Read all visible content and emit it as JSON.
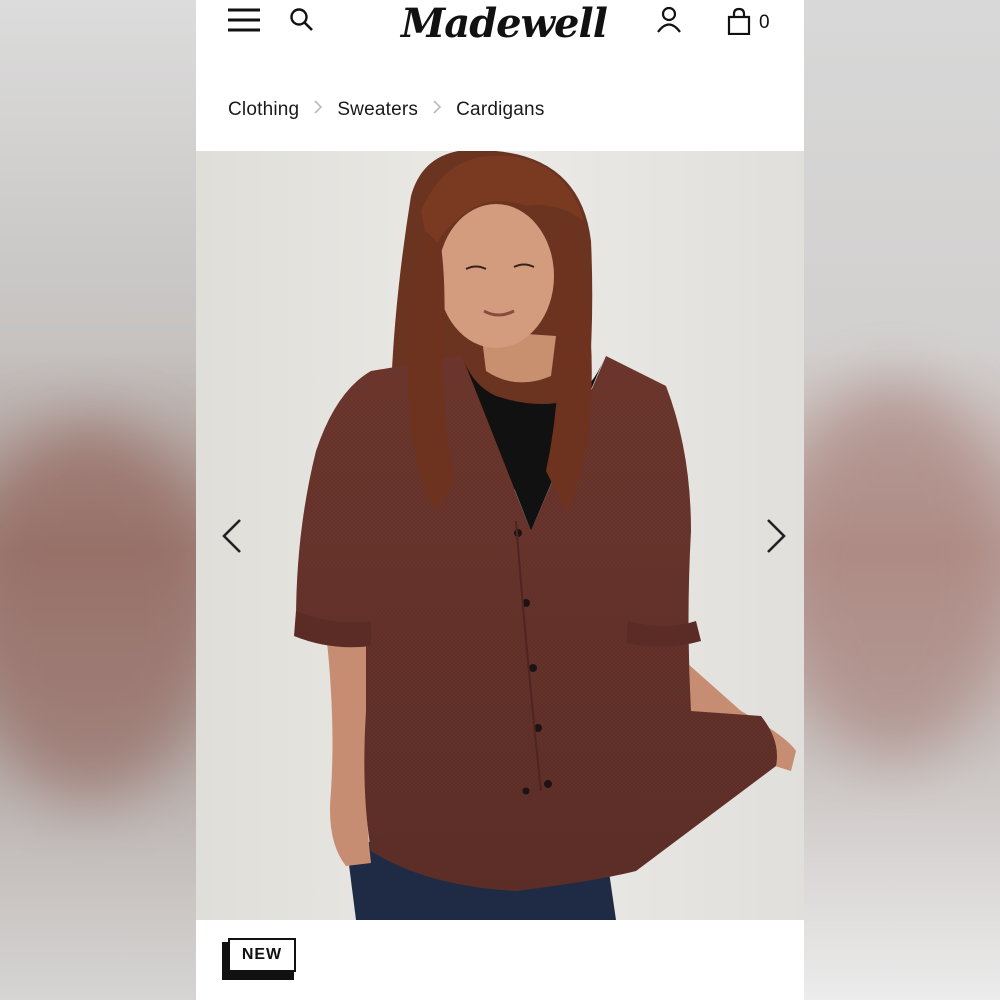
{
  "header": {
    "logo_text": "Madewell",
    "cart_count": "0",
    "icons": [
      "menu-icon",
      "search-icon",
      "account-icon",
      "shopping-bag-icon"
    ]
  },
  "breadcrumb": {
    "items": [
      "Clothing",
      "Sweaters",
      "Cardigans"
    ],
    "separator_icon": "chevron-right-icon"
  },
  "product": {
    "badge": "NEW",
    "gallery_controls": [
      "chevron-left-icon",
      "chevron-right-icon"
    ]
  },
  "colors": {
    "text": "#111111",
    "sweater": "#6a342c",
    "background": "#e6e5e1"
  }
}
